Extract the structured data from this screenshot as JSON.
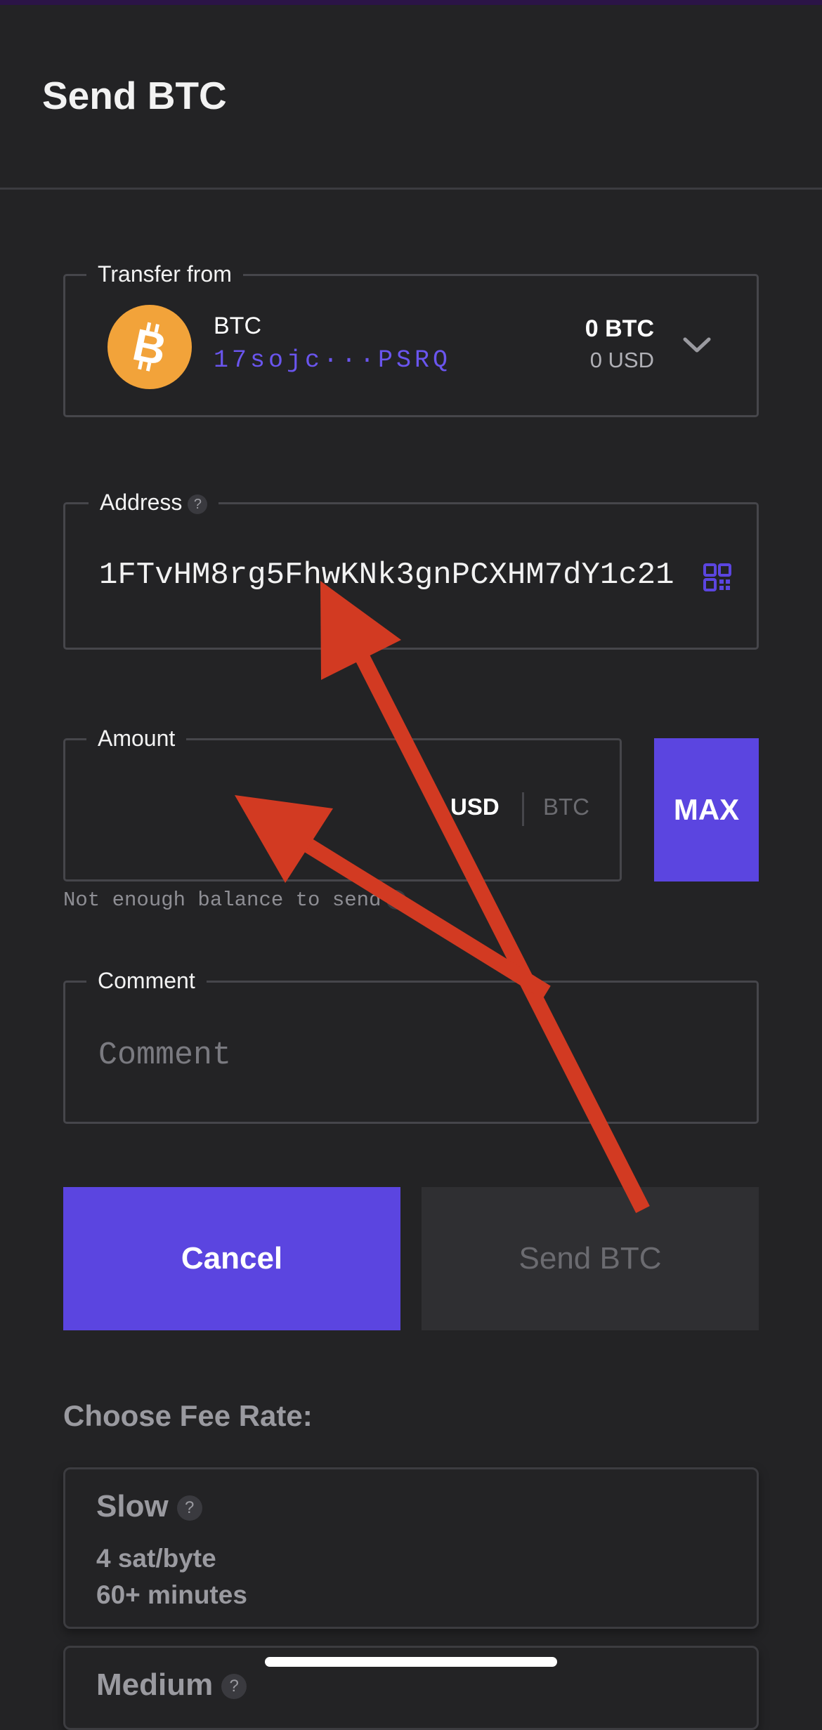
{
  "header": {
    "title": "Send BTC"
  },
  "transfer": {
    "legend": "Transfer from",
    "coin_name": "BTC",
    "address_short": "17sojc···PSRQ",
    "balance_btc": "0 BTC",
    "balance_usd": "0 USD",
    "icons": [
      "bitcoin-icon",
      "chevron-down-icon"
    ]
  },
  "address": {
    "legend": "Address",
    "help": "?",
    "value": "1FTvHM8rg5FhwKNk3gnPCXHM7dY1c21",
    "icon": "qr-code-icon"
  },
  "amount": {
    "legend": "Amount",
    "currency_usd": "USD",
    "currency_btc": "BTC",
    "max_label": "MAX",
    "note": "Not enough balance to send",
    "note_help": "?"
  },
  "comment": {
    "legend": "Comment",
    "placeholder": "Comment"
  },
  "actions": {
    "cancel_label": "Cancel",
    "send_label": "Send BTC"
  },
  "fees": {
    "title": "Choose Fee Rate:",
    "options": [
      {
        "name": "Slow",
        "help": "?",
        "rate": "4 sat/byte",
        "time": "60+ minutes"
      },
      {
        "name": "Medium",
        "help": "?"
      }
    ]
  },
  "colors": {
    "background": "#232325",
    "accent": "#5b45e0",
    "link": "#6a55ee",
    "annotation_arrow": "#d23a22",
    "bitcoin": "#f2a33a"
  }
}
